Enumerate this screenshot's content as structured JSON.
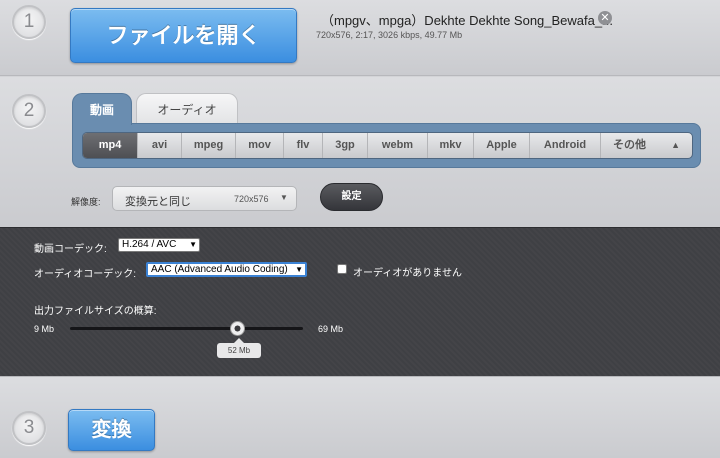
{
  "steps": {
    "step1": "1",
    "step2": "2",
    "step3": "3"
  },
  "file": {
    "open_label": "ファイルを開く",
    "name": "（mpgv、mpga）Dekhte Dekhte Song_Bewafa_...",
    "meta": "720x576, 2:17, 3026 kbps, 49.77 Mb",
    "remove_icon": "✕"
  },
  "tabs": {
    "video": "動画",
    "audio": "オーディオ"
  },
  "formats": [
    "mp4",
    "avi",
    "mpeg",
    "mov",
    "flv",
    "3gp",
    "webm",
    "mkv",
    "Apple",
    "Android"
  ],
  "formats_more": "その他",
  "active_format": "mp4",
  "resolution": {
    "label": "解像度:",
    "selected": "変換元と同じ",
    "value": "720x576"
  },
  "settings_label": "設定",
  "advanced": {
    "video_codec_label": "動画コーデック:",
    "video_codec_value": "H.264 / AVC",
    "audio_codec_label": "オーディオコーデック:",
    "audio_codec_value": "AAC (Advanced Audio Coding)",
    "no_audio_label": "オーディオがありません",
    "size_label": "出力ファイルサイズの概算:",
    "size_min": "9 Mb",
    "size_max": "69 Mb",
    "size_current": "52 Mb",
    "size_current_value_mb": 52
  },
  "convert_label": "変換",
  "colors": {
    "accent_blue": "#3b8ee0",
    "tab_blue": "#6a8db0",
    "panel_dark": "#3f4044"
  }
}
